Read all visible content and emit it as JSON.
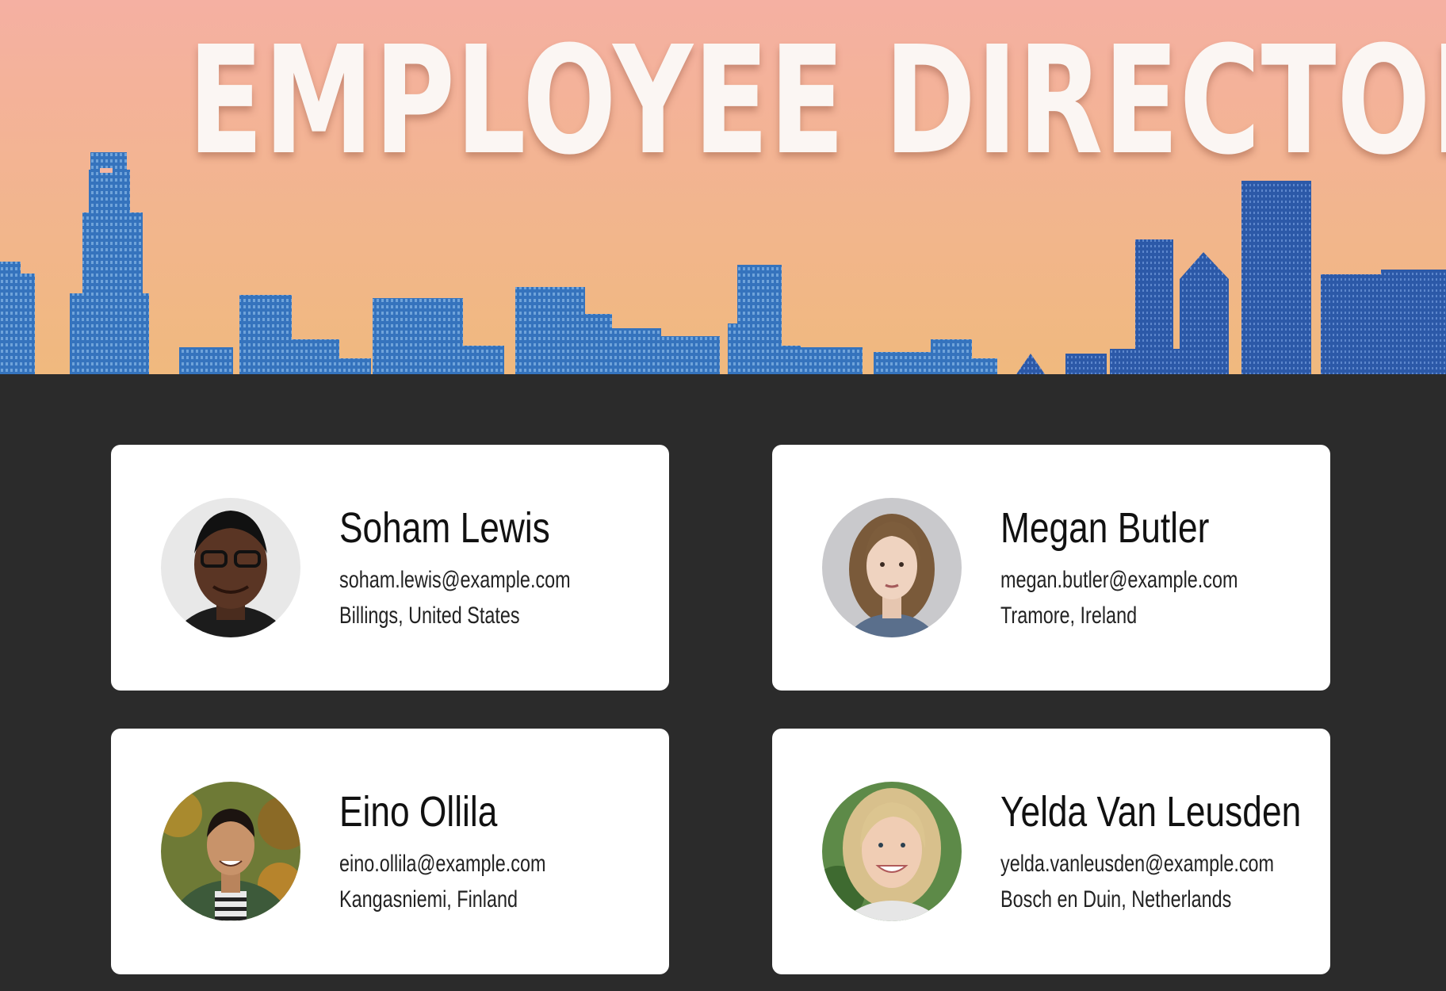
{
  "header": {
    "title": "EMPLOYEE DIRECTORY",
    "gradient": {
      "top": "#f5b0a2",
      "bottom": "#f1b87f"
    },
    "skyline_color": "#2f6bb5"
  },
  "employees": [
    {
      "name": "Soham Lewis",
      "email": "soham.lewis@example.com",
      "location": "Billings, United States"
    },
    {
      "name": "Megan Butler",
      "email": "megan.butler@example.com",
      "location": "Tramore, Ireland"
    },
    {
      "name": "Eino Ollila",
      "email": "eino.ollila@example.com",
      "location": "Kangasniemi, Finland"
    },
    {
      "name": "Yelda Van Leusden",
      "email": "yelda.vanleusden@example.com",
      "location": "Bosch en Duin, Netherlands"
    }
  ]
}
